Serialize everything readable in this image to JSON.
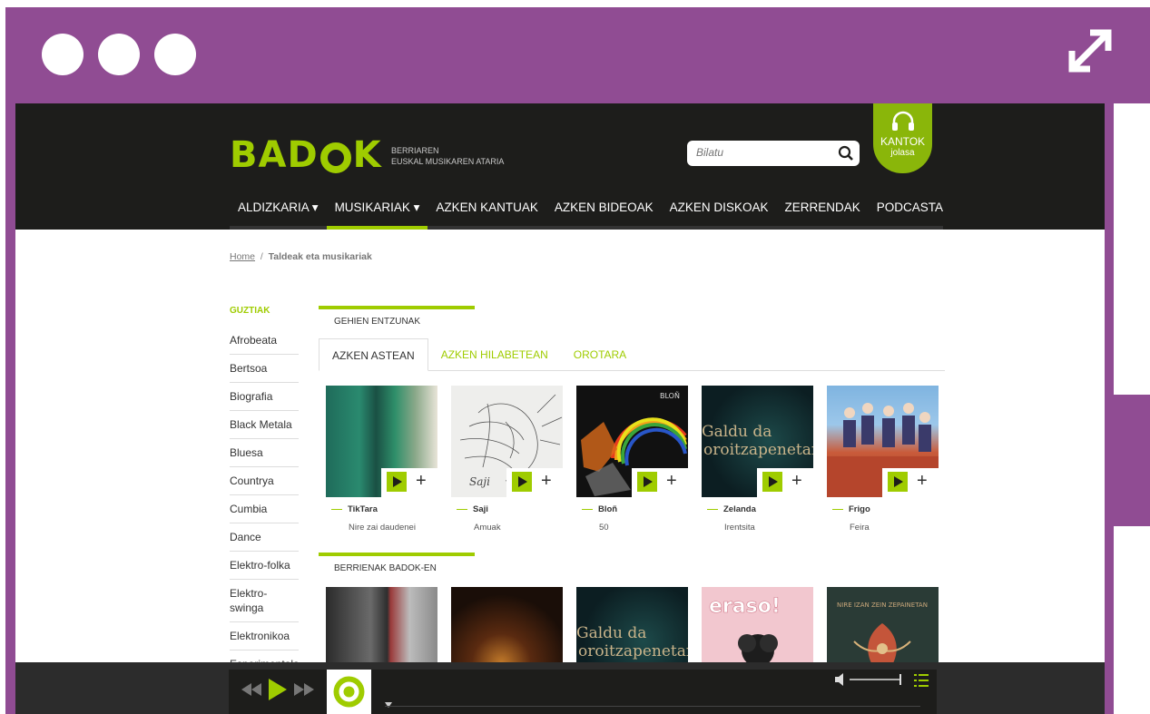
{
  "colors": {
    "frame": "#904c93",
    "accent": "#9fcc00",
    "header_bg": "#1d1d1b"
  },
  "header": {
    "logo": "BADOK",
    "tagline_1": "BERRIAREN",
    "tagline_2": "EUSKAL MUSIKAREN ATARIA",
    "search_placeholder": "Bilatu",
    "kantok_title": "KANTOK",
    "kantok_sub": "jolasa",
    "nav": [
      {
        "label": "ALDIZKARIA ▾"
      },
      {
        "label": "MUSIKARIAK ▾"
      },
      {
        "label": "AZKEN KANTUAK"
      },
      {
        "label": "AZKEN BIDEOAK"
      },
      {
        "label": "AZKEN DISKOAK"
      },
      {
        "label": "ZERRENDAK"
      },
      {
        "label": "PODCASTA"
      }
    ]
  },
  "breadcrumb": {
    "home": "Home",
    "sep": "/",
    "current": "Taldeak eta musikariak"
  },
  "sidebar": {
    "first": "GUZTIAK",
    "items": [
      "Afrobeata",
      "Bertsoa",
      "Biografia",
      "Black Metala",
      "Bluesa",
      "Countrya",
      "Cumbia",
      "Dance",
      "Elektro-folka",
      "Elektro-swinga",
      "Elektronikoa",
      "Esperimentala"
    ]
  },
  "most_listened": {
    "title": "GEHIEN ENTZUNAK",
    "tabs": [
      "AZKEN ASTEAN",
      "AZKEN HILABETEAN",
      "OROTARA"
    ],
    "cards": [
      {
        "artist": "TikTara",
        "album": "Nire zai daudenei"
      },
      {
        "artist": "Saji",
        "album": "Amuak"
      },
      {
        "artist": "Bloñ",
        "album": "50"
      },
      {
        "artist": "Zelanda",
        "album": "Irentsita"
      },
      {
        "artist": "Frigo",
        "album": "Feira"
      }
    ]
  },
  "newest": {
    "title": "BERRIENAK BADOK-EN"
  },
  "cover_text": {
    "zelanda_1": "Galdu da",
    "zelanda_2": "oroitzapenetan",
    "blon": "BLOÑ",
    "eraso": "eraso!",
    "naiz": "NIRE IZAN ZEIN ZEPAINETAN"
  },
  "icons": {
    "search": "magnifier-icon",
    "kantok": "headphones-icon",
    "expand": "expand-arrows-icon",
    "play": "play-icon",
    "plus": "plus-icon"
  }
}
